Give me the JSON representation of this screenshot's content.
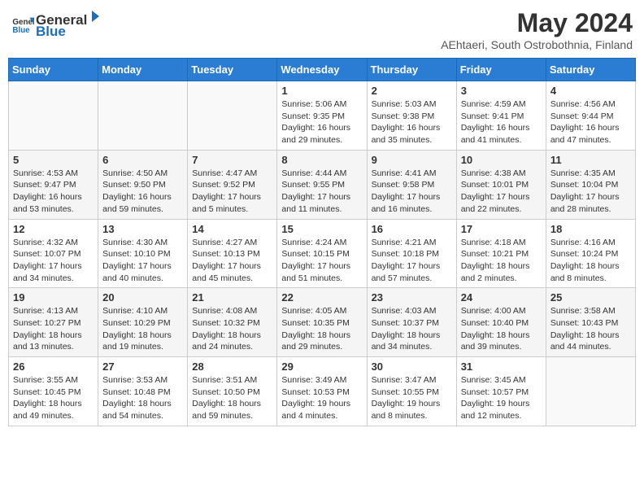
{
  "header": {
    "logo_general": "General",
    "logo_blue": "Blue",
    "title": "May 2024",
    "subtitle": "AEhtaeri, South Ostrobothnia, Finland"
  },
  "days_of_week": [
    "Sunday",
    "Monday",
    "Tuesday",
    "Wednesday",
    "Thursday",
    "Friday",
    "Saturday"
  ],
  "weeks": [
    [
      {
        "day": "",
        "info": ""
      },
      {
        "day": "",
        "info": ""
      },
      {
        "day": "",
        "info": ""
      },
      {
        "day": "1",
        "info": "Sunrise: 5:06 AM\nSunset: 9:35 PM\nDaylight: 16 hours\nand 29 minutes."
      },
      {
        "day": "2",
        "info": "Sunrise: 5:03 AM\nSunset: 9:38 PM\nDaylight: 16 hours\nand 35 minutes."
      },
      {
        "day": "3",
        "info": "Sunrise: 4:59 AM\nSunset: 9:41 PM\nDaylight: 16 hours\nand 41 minutes."
      },
      {
        "day": "4",
        "info": "Sunrise: 4:56 AM\nSunset: 9:44 PM\nDaylight: 16 hours\nand 47 minutes."
      }
    ],
    [
      {
        "day": "5",
        "info": "Sunrise: 4:53 AM\nSunset: 9:47 PM\nDaylight: 16 hours\nand 53 minutes."
      },
      {
        "day": "6",
        "info": "Sunrise: 4:50 AM\nSunset: 9:50 PM\nDaylight: 16 hours\nand 59 minutes."
      },
      {
        "day": "7",
        "info": "Sunrise: 4:47 AM\nSunset: 9:52 PM\nDaylight: 17 hours\nand 5 minutes."
      },
      {
        "day": "8",
        "info": "Sunrise: 4:44 AM\nSunset: 9:55 PM\nDaylight: 17 hours\nand 11 minutes."
      },
      {
        "day": "9",
        "info": "Sunrise: 4:41 AM\nSunset: 9:58 PM\nDaylight: 17 hours\nand 16 minutes."
      },
      {
        "day": "10",
        "info": "Sunrise: 4:38 AM\nSunset: 10:01 PM\nDaylight: 17 hours\nand 22 minutes."
      },
      {
        "day": "11",
        "info": "Sunrise: 4:35 AM\nSunset: 10:04 PM\nDaylight: 17 hours\nand 28 minutes."
      }
    ],
    [
      {
        "day": "12",
        "info": "Sunrise: 4:32 AM\nSunset: 10:07 PM\nDaylight: 17 hours\nand 34 minutes."
      },
      {
        "day": "13",
        "info": "Sunrise: 4:30 AM\nSunset: 10:10 PM\nDaylight: 17 hours\nand 40 minutes."
      },
      {
        "day": "14",
        "info": "Sunrise: 4:27 AM\nSunset: 10:13 PM\nDaylight: 17 hours\nand 45 minutes."
      },
      {
        "day": "15",
        "info": "Sunrise: 4:24 AM\nSunset: 10:15 PM\nDaylight: 17 hours\nand 51 minutes."
      },
      {
        "day": "16",
        "info": "Sunrise: 4:21 AM\nSunset: 10:18 PM\nDaylight: 17 hours\nand 57 minutes."
      },
      {
        "day": "17",
        "info": "Sunrise: 4:18 AM\nSunset: 10:21 PM\nDaylight: 18 hours\nand 2 minutes."
      },
      {
        "day": "18",
        "info": "Sunrise: 4:16 AM\nSunset: 10:24 PM\nDaylight: 18 hours\nand 8 minutes."
      }
    ],
    [
      {
        "day": "19",
        "info": "Sunrise: 4:13 AM\nSunset: 10:27 PM\nDaylight: 18 hours\nand 13 minutes."
      },
      {
        "day": "20",
        "info": "Sunrise: 4:10 AM\nSunset: 10:29 PM\nDaylight: 18 hours\nand 19 minutes."
      },
      {
        "day": "21",
        "info": "Sunrise: 4:08 AM\nSunset: 10:32 PM\nDaylight: 18 hours\nand 24 minutes."
      },
      {
        "day": "22",
        "info": "Sunrise: 4:05 AM\nSunset: 10:35 PM\nDaylight: 18 hours\nand 29 minutes."
      },
      {
        "day": "23",
        "info": "Sunrise: 4:03 AM\nSunset: 10:37 PM\nDaylight: 18 hours\nand 34 minutes."
      },
      {
        "day": "24",
        "info": "Sunrise: 4:00 AM\nSunset: 10:40 PM\nDaylight: 18 hours\nand 39 minutes."
      },
      {
        "day": "25",
        "info": "Sunrise: 3:58 AM\nSunset: 10:43 PM\nDaylight: 18 hours\nand 44 minutes."
      }
    ],
    [
      {
        "day": "26",
        "info": "Sunrise: 3:55 AM\nSunset: 10:45 PM\nDaylight: 18 hours\nand 49 minutes."
      },
      {
        "day": "27",
        "info": "Sunrise: 3:53 AM\nSunset: 10:48 PM\nDaylight: 18 hours\nand 54 minutes."
      },
      {
        "day": "28",
        "info": "Sunrise: 3:51 AM\nSunset: 10:50 PM\nDaylight: 18 hours\nand 59 minutes."
      },
      {
        "day": "29",
        "info": "Sunrise: 3:49 AM\nSunset: 10:53 PM\nDaylight: 19 hours\nand 4 minutes."
      },
      {
        "day": "30",
        "info": "Sunrise: 3:47 AM\nSunset: 10:55 PM\nDaylight: 19 hours\nand 8 minutes."
      },
      {
        "day": "31",
        "info": "Sunrise: 3:45 AM\nSunset: 10:57 PM\nDaylight: 19 hours\nand 12 minutes."
      },
      {
        "day": "",
        "info": ""
      }
    ]
  ]
}
